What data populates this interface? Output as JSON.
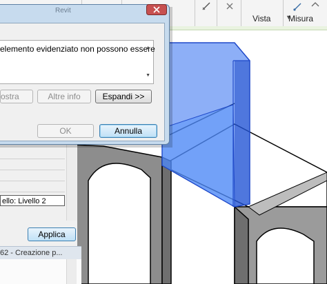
{
  "ribbon": {
    "panels": [
      {
        "label": "Vista"
      },
      {
        "label": "Misura"
      }
    ],
    "icons": [
      "close-x-icon",
      "measure-icon",
      "dimension-icon",
      "tag-icon",
      "dropdown-arrow-icon"
    ]
  },
  "dialog": {
    "title": "Revit",
    "message": "elemento evidenziato non possono essere",
    "buttons": {
      "show": "ostra",
      "more_info": "Altre info",
      "expand": "Espandi >>",
      "ok": "OK",
      "cancel": "Annulla"
    }
  },
  "properties": {
    "level_value": "ello: Livello 2",
    "apply": "Applica"
  },
  "project_browser": {
    "header": "62 - Creazione p..."
  },
  "colors": {
    "selection_blue": "#2f6ef0",
    "dialog_frame": "#c7dbee",
    "wall_gray": "#9a9a9a",
    "ribbon_green": "#e9f3e0"
  }
}
